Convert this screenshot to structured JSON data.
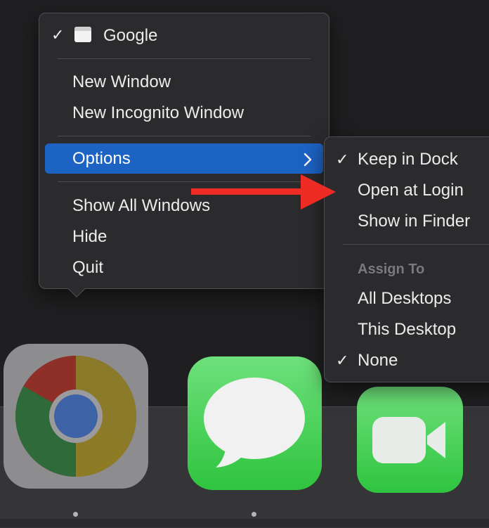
{
  "main_menu": {
    "window_item": "Google",
    "new_window": "New Window",
    "new_incognito": "New Incognito Window",
    "options": "Options",
    "show_all_windows": "Show All Windows",
    "hide": "Hide",
    "quit": "Quit"
  },
  "options_submenu": {
    "keep_in_dock": "Keep in Dock",
    "open_at_login": "Open at Login",
    "show_in_finder": "Show in Finder",
    "assign_to_label": "Assign To",
    "all_desktops": "All Desktops",
    "this_desktop": "This Desktop",
    "none": "None"
  },
  "icons": {
    "check": "✓",
    "chevron": "›"
  },
  "dock": {
    "apps": [
      "chrome-icon",
      "messages-icon",
      "facetime-icon"
    ]
  },
  "colors": {
    "highlight": "#1d63c4",
    "annotation_arrow": "#ee2b24",
    "menu_bg": "#2b2b2d",
    "section_label": "#7a7a7c"
  }
}
